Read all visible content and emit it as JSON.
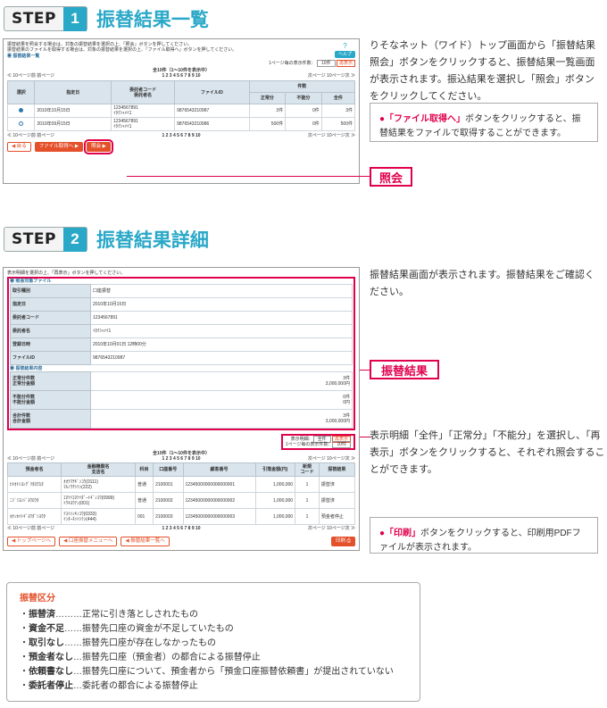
{
  "step1": {
    "label": "STEP",
    "num": "1",
    "title": "振替結果一覧",
    "desc": "りそなネット（ワイド）トップ画面から「振替結果照会」ボタンをクリックすると、振替結果一覧画面が表示されます。振込結果を選択し「照会」ボタンをクリックしてください。",
    "note_kw": "「ファイル取得へ」",
    "note_text": "ボタンをクリックすると、振替結果をファイルで取得することができます。",
    "callout": "照会",
    "shot": {
      "inst1": "振替結果を照会する場合は、対象の振替結果を選択の上、「照会」ボタンを押してください。",
      "inst2": "振替結果のファイルを取得する場合は、対象の振替結果を選択の上、「ファイル取得へ」ボタンを押してください。",
      "help": "ヘルプ",
      "section": "振替結果一覧",
      "perpage": "1ページ毎の表示件数：",
      "perpage_val": "10件",
      "redisplay": "再表示",
      "count": "全10件（1～10件を表示中）",
      "pages": "1 2 3 4 5 6 7 8 9 10",
      "prev10": "≪ 10ページ前",
      "prev": "前ページ",
      "next": "次ページ",
      "next10": "10ページ次 ≫",
      "headers": [
        "選択",
        "指定日",
        "委託者コード\n委託者名",
        "ファイルID",
        "件数",
        "正常分",
        "不能分",
        "全件"
      ],
      "rows": [
        {
          "date": "2010年10月15日",
          "code": "1234567891",
          "name": "ｲﾀｸｼｬﾒｲ1",
          "fid": "9876543210987",
          "ok": "3件",
          "ng": "0件",
          "all": "3件"
        },
        {
          "date": "2010年09月15日",
          "code": "1234567891",
          "name": "ｲﾀｸｼｬﾒｲ1",
          "fid": "9876543210986",
          "ok": "500件",
          "ng": "0件",
          "all": "500件"
        }
      ],
      "btn_back": "戻る",
      "btn_file": "ファイル取得へ",
      "btn_inquiry": "照会"
    }
  },
  "step2": {
    "label": "STEP",
    "num": "2",
    "title": "振替結果詳細",
    "desc": "振替結果画面が表示されます。振替結果をご確認ください。",
    "callout": "振替結果",
    "desc2": "表示明細「全件」「正常分」「不能分」を選択し、「再表示」ボタンをクリックすると、それぞれ照会することができます。",
    "note_kw": "「印刷」",
    "note_text": "ボタンをクリックすると、印刷用PDFファイルが表示されます。",
    "shot": {
      "inst": "表示明細を選択の上、「再表示」ボタンを押してください。",
      "sec1": "照会対象ファイル",
      "info": [
        {
          "k": "取引種別",
          "v": "口座振替"
        },
        {
          "k": "指定日",
          "v": "2010年10月15日"
        },
        {
          "k": "委託者コード",
          "v": "1234567891"
        },
        {
          "k": "委託者名",
          "v": "ｲﾀｸｼｬﾒｲ1"
        },
        {
          "k": "登録日時",
          "v": "2010年10月01日 12時00分"
        },
        {
          "k": "ファイルID",
          "v": "9876543210987"
        }
      ],
      "sec2": "振替結果内容",
      "res": [
        {
          "k1": "正常分件数",
          "k2": "正常分金額",
          "v1": "3件",
          "v2": "3,000,000円"
        },
        {
          "k1": "不能分件数",
          "k2": "不能分金額",
          "v1": "0件",
          "v2": "0円"
        },
        {
          "k1": "合計件数",
          "k2": "合計金額",
          "v1": "3件",
          "v2": "3,000,000円"
        }
      ],
      "display_label": "表示明細：",
      "display_val": "全件",
      "perpage": "1ページ毎の表示件数：",
      "perpage_val": "10件",
      "redisplay": "再表示",
      "count": "全10件（1～10件を表示中）",
      "pages": "1 2 3 4 5 6 7 8 9 10",
      "prev10": "≪ 10ページ前",
      "prev": "前ページ",
      "next": "次ページ",
      "next10": "10ページ次 ≫",
      "headers": [
        "預金者名",
        "金融機関名\n支店名",
        "科目",
        "口座番号",
        "顧客番号",
        "引落金額(円)",
        "新規\nコード",
        "振替結果"
      ],
      "rows": [
        {
          "name": "ﾋｷｵﾄｼﾖﾝｸﾞﾘﾀﾛｳ1ﾀ",
          "bank": "ｵｵﾃﾏﾁｷﾞﾝｺｳ(0111)",
          "branch": "ﾏﾙﾉｳﾁｼﾃﾝ(222)",
          "kamoku": "普通",
          "acct": "2100001",
          "cust": "12345000000000000001",
          "amt": "1,000,000",
          "code": "1",
          "res": "振替済"
        },
        {
          "name": "ﾆｼﾞﾐﾖﾝｼﾞﾖｳﾛｳﾀ",
          "bank": "ｴﾇﾃｲｴﾇﾃｲﾀﾞｰﾄｷﾞﾝｺｳ(0999)",
          "branch": "ﾄｳｷﾖｳﾃﾝ(001)",
          "kamoku": "普通",
          "acct": "2100002",
          "cust": "12345000000000000002",
          "amt": "1,000,000",
          "code": "1",
          "res": "振替済"
        },
        {
          "name": "ﾎｹﾝｶｲﾄｷﾞﾖｳﾀﾞｼﾖｳﾀ",
          "bank": "ﾃｽﾄｼﾝｷﾝｺｳ(0333)",
          "branch": "ｲﾝﾀｰﾈｯﾄｼﾃﾝ(444)",
          "kamoku": "001",
          "acct": "2100003",
          "cust": "12345000000000000003",
          "amt": "1,000,000",
          "code": "1",
          "res": "預金者停止"
        }
      ],
      "btn_top": "トップページへ",
      "btn_menu": "口座振替メニューへ",
      "btn_list": "振替結果一覧へ",
      "btn_print": "印刷"
    }
  },
  "legend": {
    "title": "振替区分",
    "items": [
      {
        "k": "振替済",
        "sep": "………",
        "v": "正常に引き落としされたもの"
      },
      {
        "k": "資金不足",
        "sep": "……",
        "v": "振替先口座の資金が不足していたもの"
      },
      {
        "k": "取引なし",
        "sep": "……",
        "v": "振替先口座が存在しなかったもの"
      },
      {
        "k": "預金者なし",
        "sep": "…",
        "v": "振替先口座（預金者）の都合による振替停止"
      },
      {
        "k": "依頼書なし",
        "sep": "…",
        "v": "振替先口座について、預金者から「預金口座振替依頼書」が提出されていない"
      },
      {
        "k": "委託者停止",
        "sep": "…",
        "v": "委託者の都合による振替停止"
      }
    ]
  },
  "colors": {
    "accent": "#2aa8c8",
    "callout": "#e0004d",
    "button": "#e4502a"
  }
}
